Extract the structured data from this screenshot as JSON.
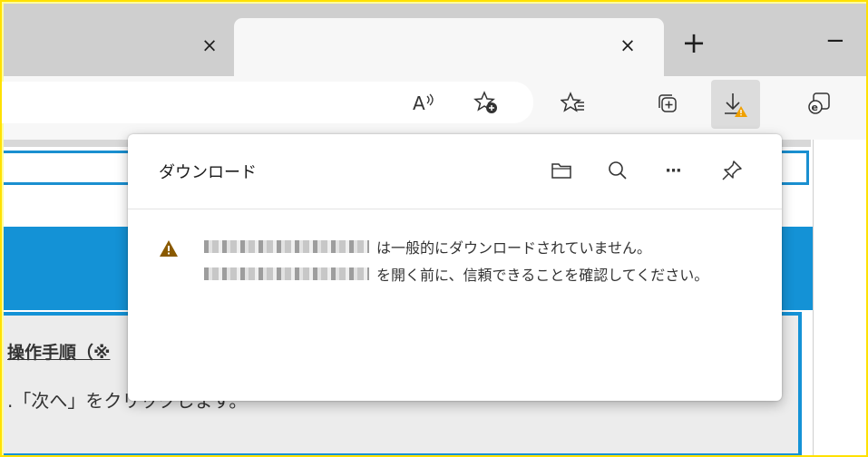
{
  "tabs": {
    "inactive_close_glyph": "×",
    "active_close_glyph": "×",
    "new_tab_glyph": "+",
    "minimize_glyph": "−"
  },
  "toolbar": {
    "icons": [
      "read-aloud-icon",
      "add-favorite-icon",
      "favorites-icon",
      "collections-icon",
      "downloads-icon",
      "ie-mode-icon"
    ],
    "warning_color": "#f0a000"
  },
  "page": {
    "step_heading": "操作手順（※",
    "step_text": ".「次へ」をクリックします。"
  },
  "downloads": {
    "title": "ダウンロード",
    "icons": [
      "open-folder-icon",
      "search-icon",
      "more-options-icon",
      "pin-icon"
    ],
    "more_glyph": "···",
    "message_line1": "は一般的にダウンロードされていません。",
    "message_line2": "を開く前に、信頼できることを確認してください。",
    "warning_icon_color": "#8a5a00"
  }
}
